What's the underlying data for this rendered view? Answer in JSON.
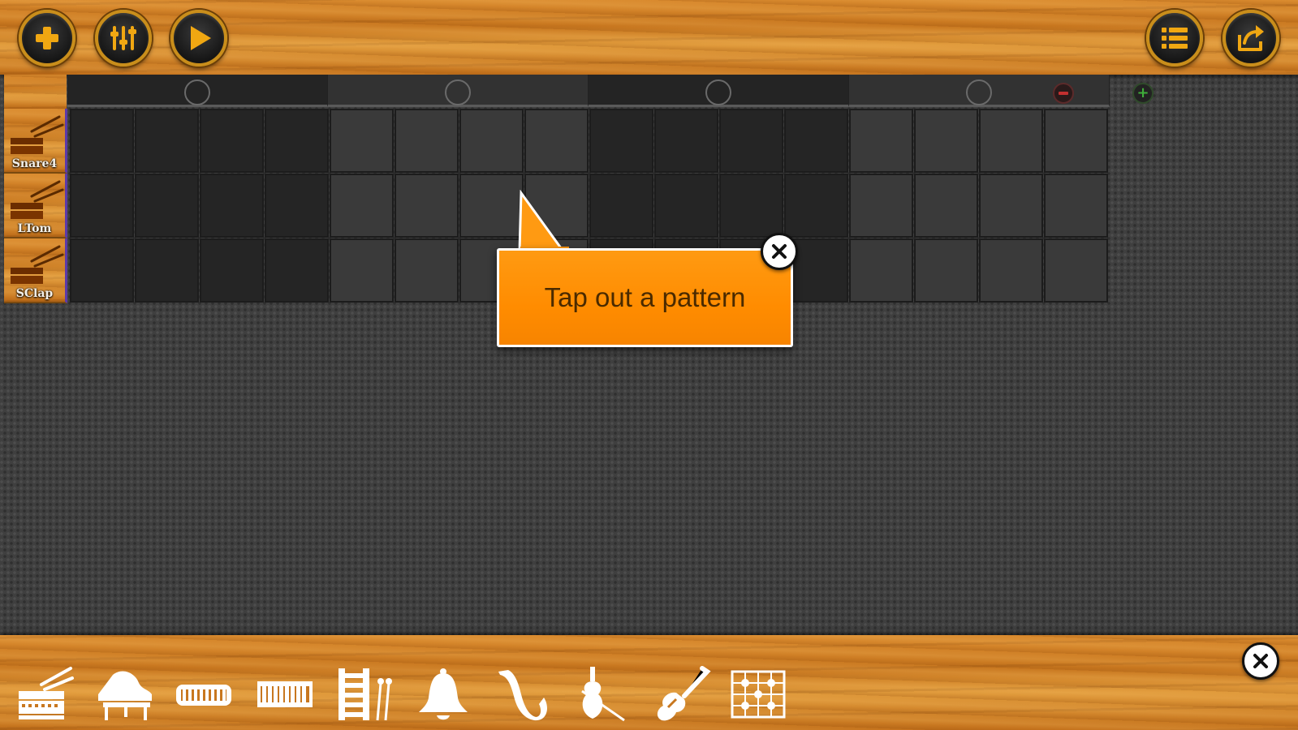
{
  "toolbar": {
    "left_buttons": [
      {
        "icon": "plus-icon",
        "label": "add"
      },
      {
        "icon": "mixer-icon",
        "label": "mixer"
      },
      {
        "icon": "play-icon",
        "label": "play"
      }
    ],
    "right_buttons": [
      {
        "icon": "list-icon",
        "label": "list"
      },
      {
        "icon": "share-icon",
        "label": "share"
      }
    ],
    "accent_color": "#c98e1b"
  },
  "sequencer": {
    "beats_per_segment": 4,
    "segment_count": 4,
    "tracks": [
      {
        "name": "Snare4",
        "icon": "snare-drum-icon"
      },
      {
        "name": "LTom",
        "icon": "snare-drum-icon"
      },
      {
        "name": "SClap",
        "icon": "snare-drum-icon"
      }
    ],
    "remove_segment_color": "#c23030",
    "add_segment_color": "#3fae3a"
  },
  "tooltip": {
    "text": "Tap out a pattern",
    "background": "#ff8c00"
  },
  "instrument_bar": {
    "items": [
      "drum-icon",
      "grand-piano-icon",
      "keyboard-icon",
      "synth-keyboard-icon",
      "xylophone-icon",
      "bell-icon",
      "saxophone-icon",
      "violin-icon",
      "electric-guitar-icon",
      "chord-grid-icon"
    ]
  }
}
